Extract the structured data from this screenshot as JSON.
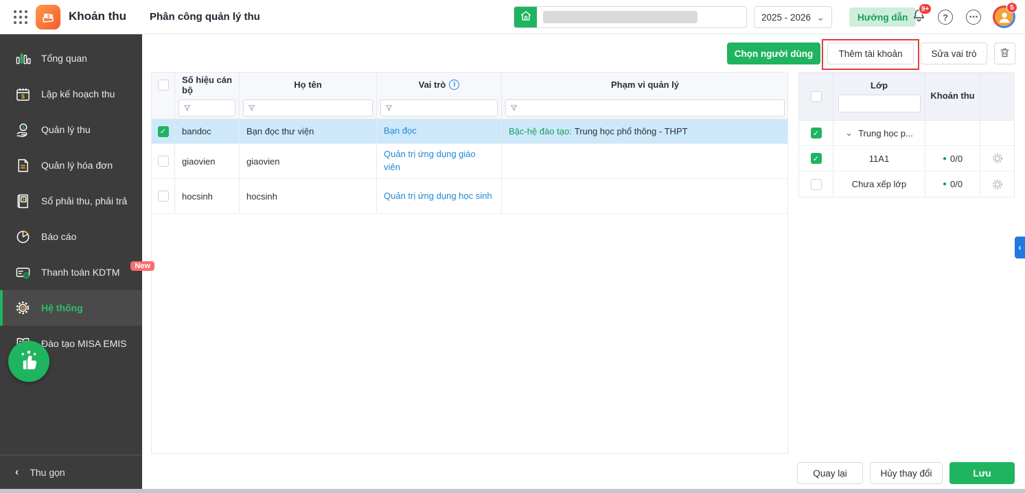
{
  "icons": {
    "chevron_down": "⌄",
    "chevron_left": "‹",
    "check": "✓",
    "ellipsis": "⋯",
    "question": "?",
    "info": "i",
    "dot": "●"
  },
  "header": {
    "app_name": "Khoản thu",
    "page_title": "Phân công quản lý thu",
    "school_year": "2025 - 2026",
    "guide_label": "Hướng dẫn",
    "bell_badge": "9+",
    "avatar_badge": "5"
  },
  "sidebar": {
    "items": [
      {
        "label": "Tổng quan"
      },
      {
        "label": "Lập kế hoạch thu"
      },
      {
        "label": "Quản lý thu"
      },
      {
        "label": "Quản lý hóa đơn"
      },
      {
        "label": "Sổ phải thu, phải trả"
      },
      {
        "label": "Báo cáo"
      },
      {
        "label": "Thanh toán KDTM",
        "badge": "New"
      },
      {
        "label": "Hệ thống",
        "active": true
      },
      {
        "label": "Đào tạo MISA EMIS"
      }
    ],
    "collapse_label": "Thu gọn"
  },
  "toolbar": {
    "choose_user_label": "Chọn người dùng",
    "add_account_label": "Thêm tài khoản",
    "edit_role_label": "Sửa vai trò"
  },
  "main_table": {
    "columns": [
      "Số hiệu cán bộ",
      "Họ tên",
      "Vai trò",
      "Phạm vi quản lý"
    ],
    "rows": [
      {
        "code": "bandoc",
        "name": "Bạn đọc thư viện",
        "role": "Bạn đọc",
        "scope_label": "Bậc-hệ đào tạo:",
        "scope_value": "Trung học phổ thông - THPT",
        "checked": true,
        "selected": true
      },
      {
        "code": "giaovien",
        "name": "giaovien",
        "role": "Quản trị ứng dụng giáo viên",
        "checked": false
      },
      {
        "code": "hocsinh",
        "name": "hocsinh",
        "role": "Quản trị ứng dụng học sinh",
        "checked": false
      }
    ]
  },
  "class_table": {
    "columns": [
      "Lớp",
      "Khoản thu"
    ],
    "rows": [
      {
        "label": "Trung học p...",
        "checked": true,
        "expandable": true
      },
      {
        "label": "11A1",
        "count": "0/0",
        "checked": true
      },
      {
        "label": "Chưa xếp lớp",
        "count": "0/0",
        "checked": false
      }
    ]
  },
  "footer": {
    "back_label": "Quay lại",
    "cancel_label": "Hủy thay đổi",
    "save_label": "Lưu"
  },
  "colors": {
    "accent_green": "#1fb45f",
    "link_blue": "#1e88d2",
    "selected_row": "#cee8fb",
    "annotation_red": "#e23b3b",
    "sidebar_bg": "#3c3c3c",
    "badge_red": "#f03e3e",
    "new_badge": "#fa6d6d"
  }
}
